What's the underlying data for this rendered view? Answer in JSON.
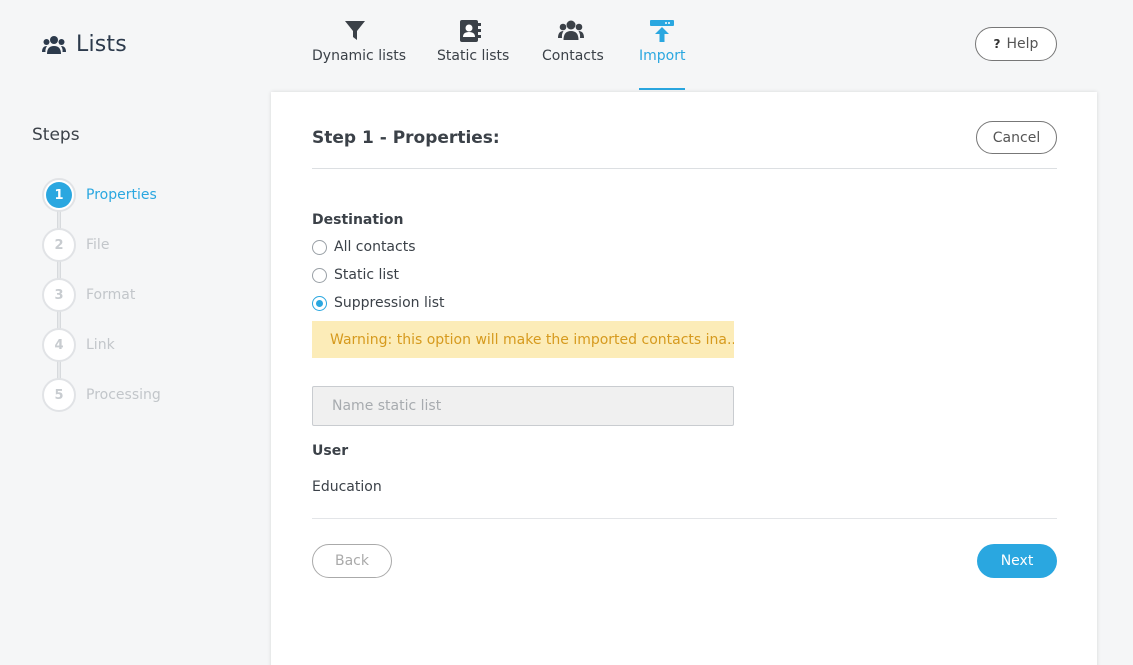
{
  "app": {
    "title": "Lists",
    "icon": "users-icon"
  },
  "nav": [
    {
      "label": "Dynamic lists",
      "icon": "filter-icon",
      "active": false
    },
    {
      "label": "Static lists",
      "icon": "address-book-icon",
      "active": false
    },
    {
      "label": "Contacts",
      "icon": "users-icon",
      "active": false
    },
    {
      "label": "Import",
      "icon": "upload-icon",
      "active": true
    }
  ],
  "help": {
    "label": "Help",
    "icon": "question-icon"
  },
  "sidebar": {
    "title": "Steps",
    "steps": [
      {
        "number": "1",
        "label": "Properties",
        "active": true
      },
      {
        "number": "2",
        "label": "File",
        "active": false
      },
      {
        "number": "3",
        "label": "Format",
        "active": false
      },
      {
        "number": "4",
        "label": "Link",
        "active": false
      },
      {
        "number": "5",
        "label": "Processing",
        "active": false
      }
    ]
  },
  "panel": {
    "title": "Step 1 - Properties:",
    "cancel_label": "Cancel",
    "destination_label": "Destination",
    "options": [
      {
        "label": "All contacts",
        "checked": false
      },
      {
        "label": "Static list",
        "checked": false
      },
      {
        "label": "Suppression list",
        "checked": true
      }
    ],
    "warning": "Warning: this option will make the imported contacts ina...",
    "name_placeholder": "Name static list",
    "user_label": "User",
    "user_value": "Education",
    "back_label": "Back",
    "next_label": "Next"
  },
  "colors": {
    "accent": "#2aa7e0",
    "warning_bg": "#fcecb8",
    "warning_text": "#d69a1e"
  }
}
